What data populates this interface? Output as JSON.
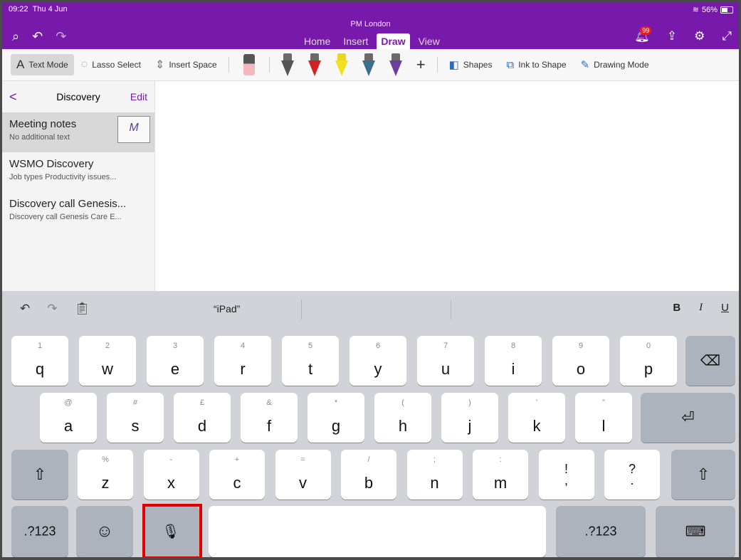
{
  "status": {
    "time": "09:22",
    "date": "Thu 4 Jun",
    "battery": "56%"
  },
  "header": {
    "doc_title": "PM London",
    "tabs": [
      {
        "label": "Home",
        "active": false
      },
      {
        "label": "Insert",
        "active": false
      },
      {
        "label": "Draw",
        "active": true
      },
      {
        "label": "View",
        "active": false
      }
    ],
    "notification_count": "99"
  },
  "ribbon": {
    "text_mode": "Text Mode",
    "lasso": "Lasso Select",
    "insert_space": "Insert Space",
    "pens": [
      "#555555",
      "#d42020",
      "#f2e020",
      "#3b6e8f",
      "#6b3fa0"
    ],
    "add": "+",
    "shapes": "Shapes",
    "ink_to_shape": "Ink to Shape",
    "drawing_mode": "Drawing Mode"
  },
  "sidebar": {
    "back": "<",
    "title": "Discovery",
    "edit": "Edit",
    "pages": [
      {
        "title": "Meeting notes",
        "subtitle": "No additional text",
        "selected": true
      },
      {
        "title": "WSMO Discovery",
        "subtitle": "Job types  Productivity issues...",
        "selected": false
      },
      {
        "title": "Discovery call Genesis...",
        "subtitle": "Discovery call Genesis Care E...",
        "selected": false
      }
    ]
  },
  "keyboard": {
    "suggestion": "“iPad”",
    "format": {
      "bold": "B",
      "italic": "I",
      "underline": "U"
    },
    "row1": [
      {
        "c": "q",
        "h": "1"
      },
      {
        "c": "w",
        "h": "2"
      },
      {
        "c": "e",
        "h": "3"
      },
      {
        "c": "r",
        "h": "4"
      },
      {
        "c": "t",
        "h": "5"
      },
      {
        "c": "y",
        "h": "6"
      },
      {
        "c": "u",
        "h": "7"
      },
      {
        "c": "i",
        "h": "8"
      },
      {
        "c": "o",
        "h": "9"
      },
      {
        "c": "p",
        "h": "0"
      }
    ],
    "row2": [
      {
        "c": "a",
        "h": "@"
      },
      {
        "c": "s",
        "h": "#"
      },
      {
        "c": "d",
        "h": "£"
      },
      {
        "c": "f",
        "h": "&"
      },
      {
        "c": "g",
        "h": "*"
      },
      {
        "c": "h",
        "h": "("
      },
      {
        "c": "j",
        "h": ")"
      },
      {
        "c": "k",
        "h": "’"
      },
      {
        "c": "l",
        "h": "”"
      }
    ],
    "row3": [
      {
        "c": "z",
        "h": "%"
      },
      {
        "c": "x",
        "h": "-"
      },
      {
        "c": "c",
        "h": "+"
      },
      {
        "c": "v",
        "h": "="
      },
      {
        "c": "b",
        "h": "/"
      },
      {
        "c": "n",
        "h": ";"
      },
      {
        "c": "m",
        "h": ":"
      },
      {
        "c": "!\n,",
        "h": ""
      },
      {
        "c": "?\n.",
        "h": ""
      }
    ],
    "numbers_label": ".?123",
    "numbers_label_right": ".?123"
  }
}
